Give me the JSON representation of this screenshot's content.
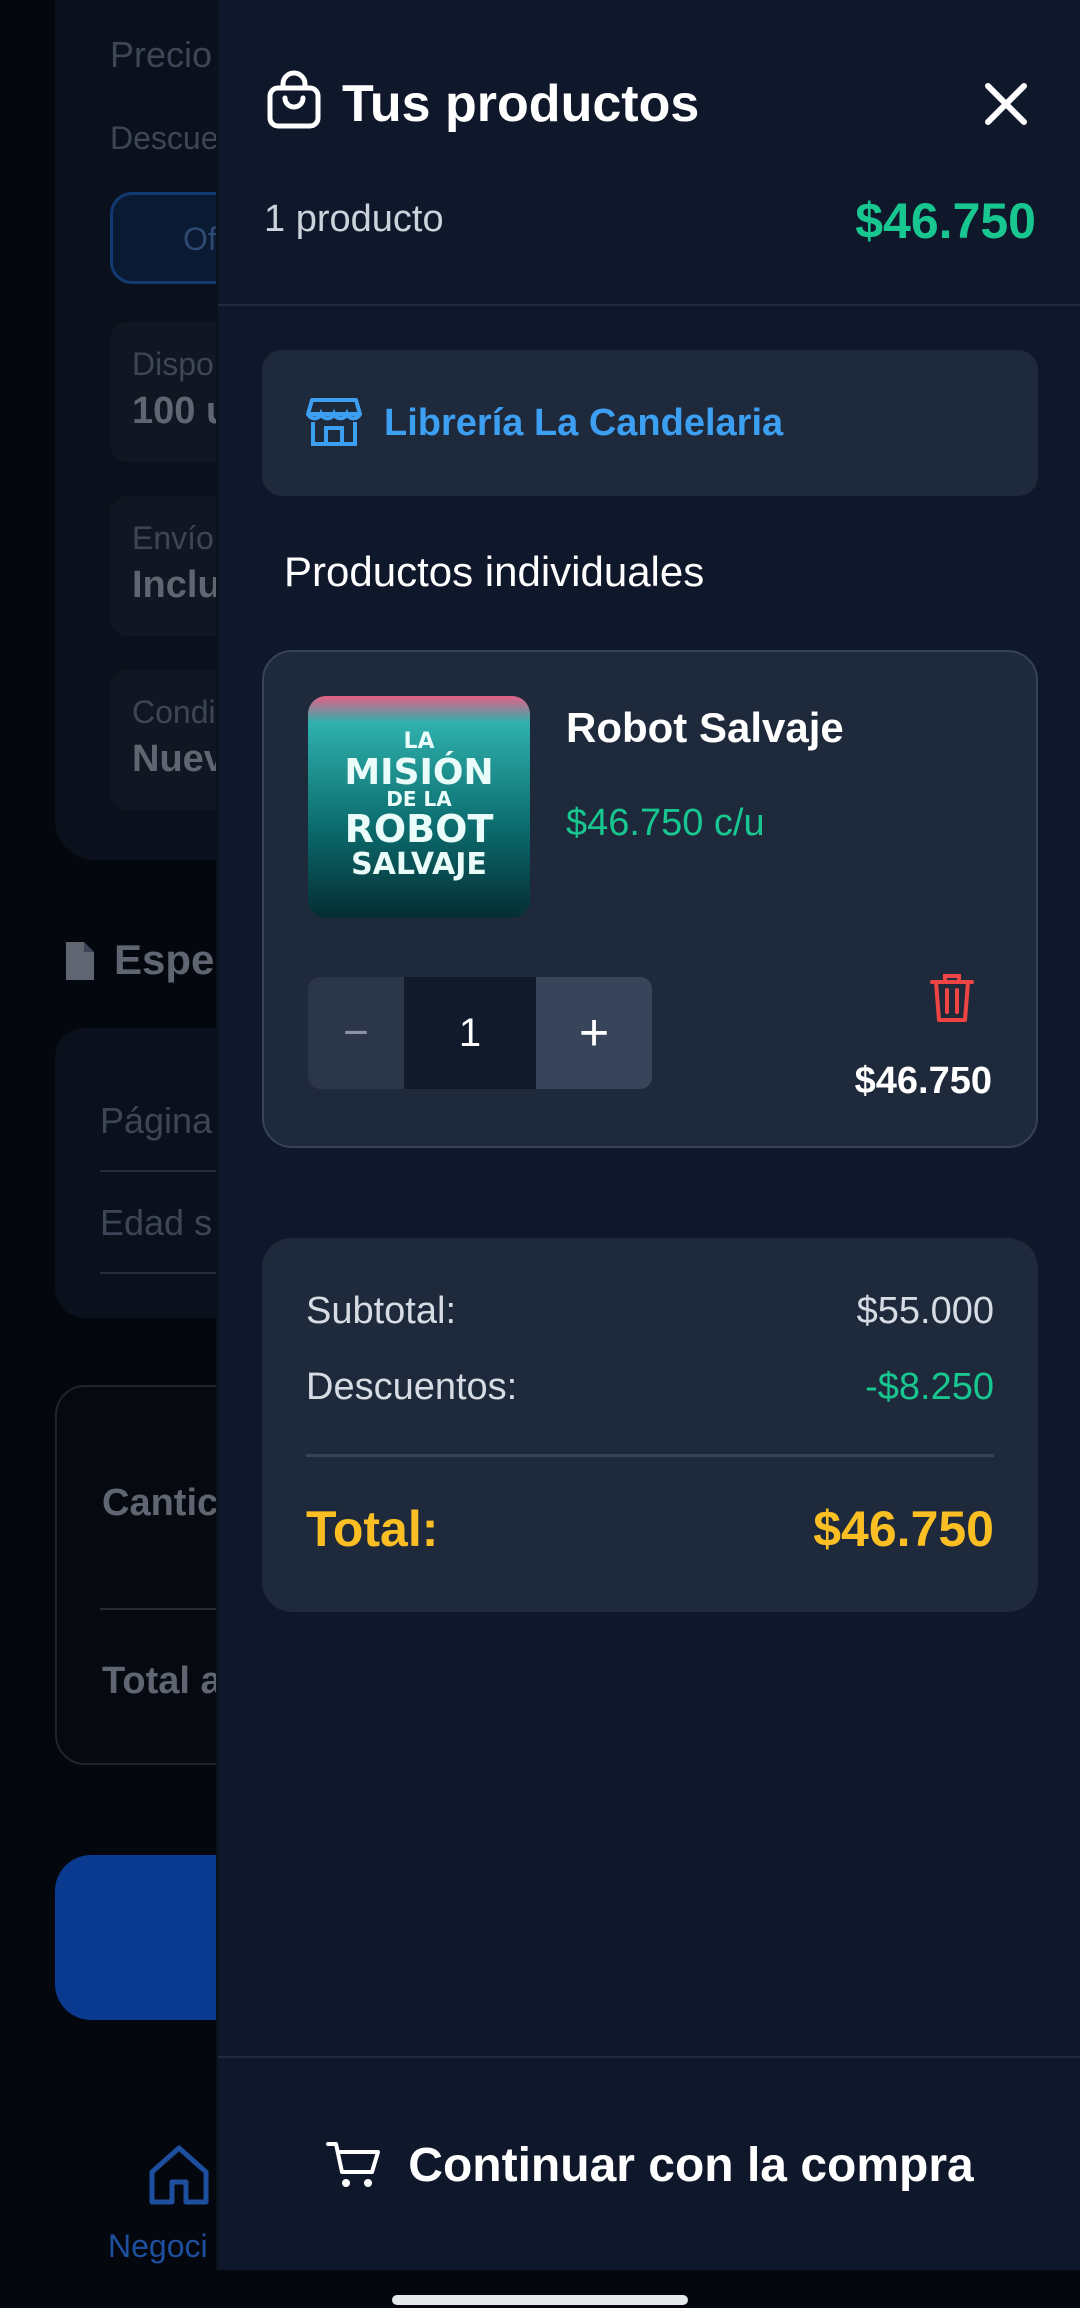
{
  "background_page": {
    "precio_label": "Precio",
    "descuento_label": "Descue",
    "offer_button": "Of",
    "disponible_label": "Dispo",
    "disponible_value": "100 u",
    "envio_label": "Envío",
    "envio_value": "Inclu",
    "condicion_label": "Condi",
    "condicion_value": "Nuev",
    "specs_title": "Espec",
    "paginas_label": "Página",
    "edad_label": "Edad s",
    "cantidad_label": "Cantic",
    "total_label": "Total a",
    "nav_home_label": "Negoci"
  },
  "drawer": {
    "title": "Tus productos",
    "product_count": "1 producto",
    "header_total": "$46.750",
    "store_name": "Librería La Candelaria",
    "section_label": "Productos individuales",
    "product": {
      "name": "Robot Salvaje",
      "unit_price": "$46.750 c/u",
      "cover_lines": [
        "LA",
        "MISIÓN",
        "DE LA",
        "ROBOT",
        "SALVAJE"
      ],
      "quantity": "1",
      "minus_label": "−",
      "plus_label": "+",
      "line_total": "$46.750"
    },
    "summary": {
      "subtotal_label": "Subtotal:",
      "subtotal_value": "$55.000",
      "discount_label": "Descuentos:",
      "discount_value": "-$8.250",
      "total_label": "Total:",
      "total_value": "$46.750"
    },
    "continue_label": "Continuar con la compra"
  },
  "colors": {
    "drawer_bg": "#0f172a",
    "card_bg": "#1e293b",
    "green": "#18c68f",
    "yellow": "#fbbf24",
    "blue": "#3d9ff2",
    "red": "#ef4444"
  },
  "icons": [
    "shopping-bag-icon",
    "close-icon",
    "store-icon",
    "trash-icon",
    "cart-icon",
    "home-icon",
    "document-icon"
  ]
}
